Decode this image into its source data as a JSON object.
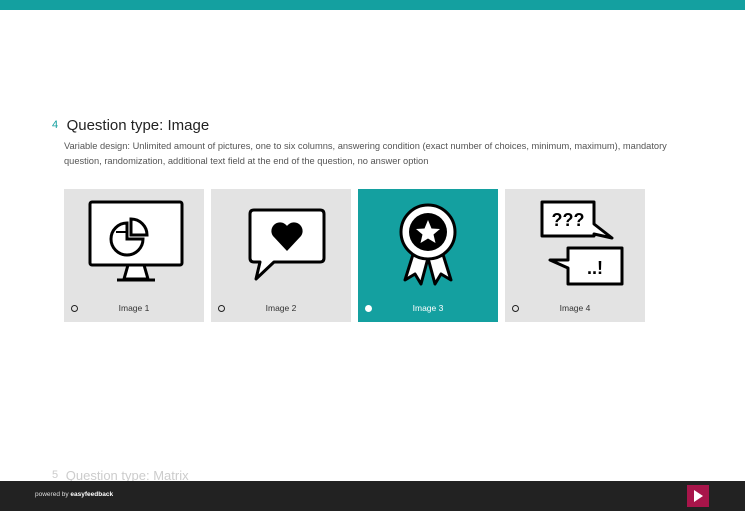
{
  "question": {
    "number": "4",
    "title": "Question type: Image",
    "description": "Variable design: Unlimited amount of pictures, one to six columns, answering condition (exact number of choices, minimum, maximum), mandatory question, randomization, additional text field at the end of the question, no answer option"
  },
  "choices": [
    {
      "label": "Image 1",
      "icon": "monitor-pie-chart-icon",
      "selected": false
    },
    {
      "label": "Image 2",
      "icon": "speech-bubble-heart-icon",
      "selected": false
    },
    {
      "label": "Image 3",
      "icon": "award-badge-star-icon",
      "selected": true
    },
    {
      "label": "Image 4",
      "icon": "question-exclamation-bubbles-icon",
      "selected": false
    }
  ],
  "next_question": {
    "number": "5",
    "title": "Question type: Matrix"
  },
  "footer": {
    "powered_prefix": "powered by",
    "brand": "easyfeedback",
    "next_icon": "play-triangle-icon"
  },
  "colors": {
    "accent": "#14a0a0",
    "next_button": "#a8154a",
    "footer_bg": "#222222",
    "choice_bg": "#e3e3e3"
  }
}
